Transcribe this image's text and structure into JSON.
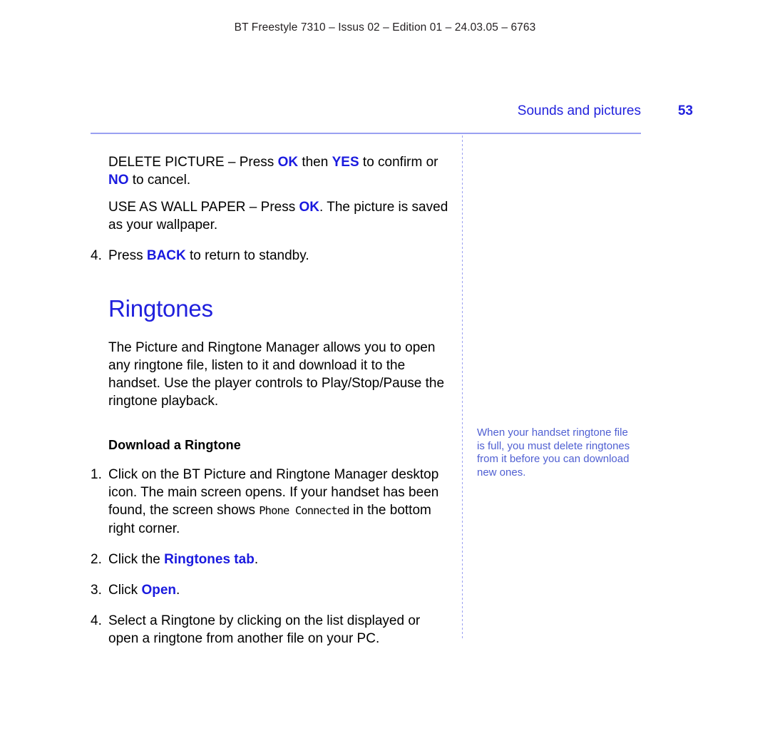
{
  "document": {
    "running_header": "BT Freestyle 7310 – Issus 02 – Edition 01 – 24.03.05 – 6763",
    "section_title": "Sounds and pictures",
    "page_number": "53"
  },
  "colors": {
    "accent_blue": "#2020dd",
    "inline_bold_blue": "#1a1adf",
    "note_blue": "#4f5fd2",
    "rule_blue": "#9aa0f2",
    "body_text": "#000000"
  },
  "main": {
    "para_delete": {
      "p1": "DELETE PICTURE – Press ",
      "ok": "OK",
      "p2": " then ",
      "yes": "YES",
      "p3": " to confirm or ",
      "no": "NO",
      "p4": " to cancel."
    },
    "para_wallpaper": {
      "p1": "USE AS WALL PAPER – Press ",
      "ok": "OK",
      "p2": ". The picture is saved as your wallpaper."
    },
    "item_back": {
      "number": "4.",
      "p1": "Press ",
      "back": "BACK",
      "p2": " to return to standby."
    },
    "section_heading": "Ringtones",
    "intro_paragraph": "The Picture and Ringtone Manager allows you to open any ringtone file, listen to it and download it to the handset. Use the player controls to Play/Stop/Pause the ringtone playback.",
    "sub_heading": "Download a Ringtone",
    "steps": {
      "step1": {
        "number": "1.",
        "p1": "Click on the BT Picture and Ringtone Manager desktop icon. The main screen opens. If your handset has been found, the screen shows ",
        "phone_connected": "Phone Connected",
        "p2": " in the bottom right corner."
      },
      "step2": {
        "number": "2.",
        "p1": "Click the ",
        "ringtones_tab": "Ringtones tab",
        "p2": "."
      },
      "step3": {
        "number": "3.",
        "p1": "Click ",
        "open": "Open",
        "p2": "."
      },
      "step4": {
        "number": "4.",
        "p1": "Select a Ringtone by clicking on the list displayed or open a ringtone from another file on your PC."
      }
    }
  },
  "side_note": {
    "text": "When your handset ringtone file is full, you must delete ringtones from it before you can download new ones."
  }
}
